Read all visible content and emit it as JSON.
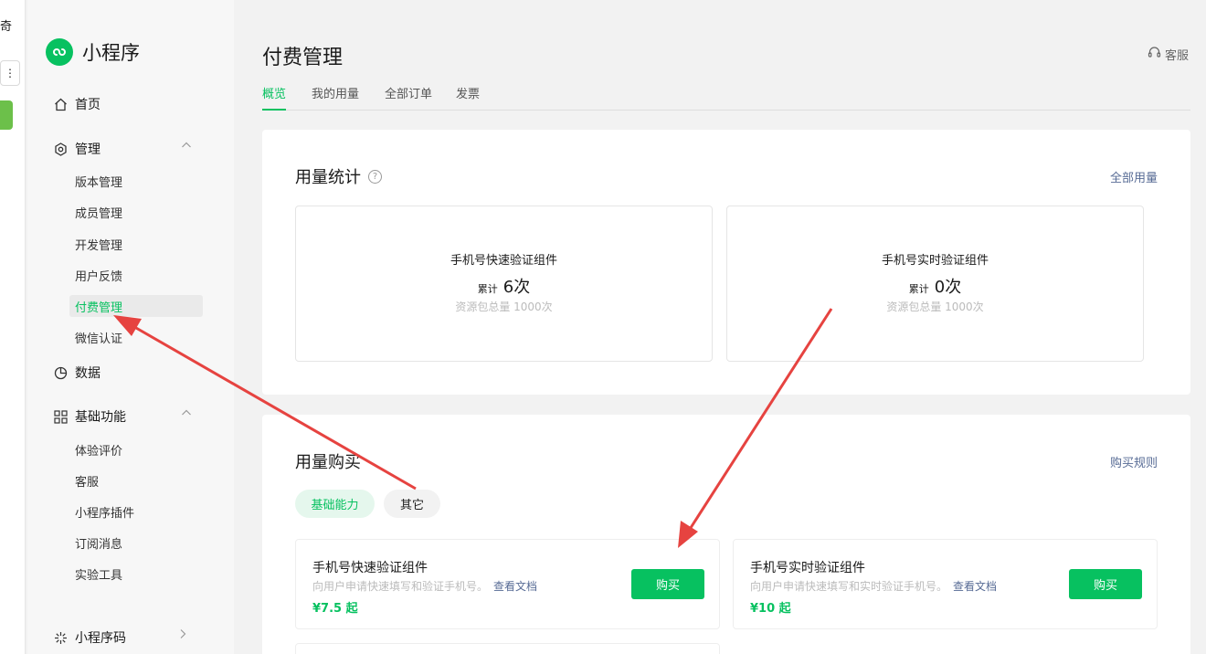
{
  "edge": {
    "char": "奇",
    "menu_glyph": "⋮"
  },
  "sidebar": {
    "logo_text": "小程序",
    "home": "首页",
    "manage": {
      "label": "管理",
      "items": [
        "版本管理",
        "成员管理",
        "开发管理",
        "用户反馈",
        "付费管理",
        "微信认证"
      ]
    },
    "data": "数据",
    "basic": {
      "label": "基础功能",
      "items": [
        "体验评价",
        "客服",
        "小程序插件",
        "订阅消息",
        "实验工具"
      ]
    },
    "qrcode": "小程序码"
  },
  "header": {
    "title": "付费管理",
    "service": "客服",
    "tabs": [
      "概览",
      "我的用量",
      "全部订单",
      "发票"
    ],
    "active_tab": "概览"
  },
  "usage": {
    "title": "用量统计",
    "help_icon": "?",
    "all_link": "全部用量",
    "stats": [
      {
        "name": "手机号快速验证组件",
        "prefix": "累计",
        "value": "6次",
        "quota": "资源包总量 1000次"
      },
      {
        "name": "手机号实时验证组件",
        "prefix": "累计",
        "value": "0次",
        "quota": "资源包总量 1000次"
      }
    ]
  },
  "purchase": {
    "title": "用量购买",
    "rules_link": "购买规则",
    "pills": [
      "基础能力",
      "其它"
    ],
    "items": [
      {
        "title": "手机号快速验证组件",
        "desc": "向用户申请快速填写和验证手机号。",
        "doc": "查看文档",
        "price": "¥7.5 起",
        "button": "购买"
      },
      {
        "title": "手机号实时验证组件",
        "desc": "向用户申请快速填写和实时验证手机号。",
        "doc": "查看文档",
        "price": "¥10 起",
        "button": "购买"
      }
    ]
  },
  "colors": {
    "brand_green": "#07c160",
    "link_blue": "#576b95",
    "arrow_red": "#e64340"
  }
}
